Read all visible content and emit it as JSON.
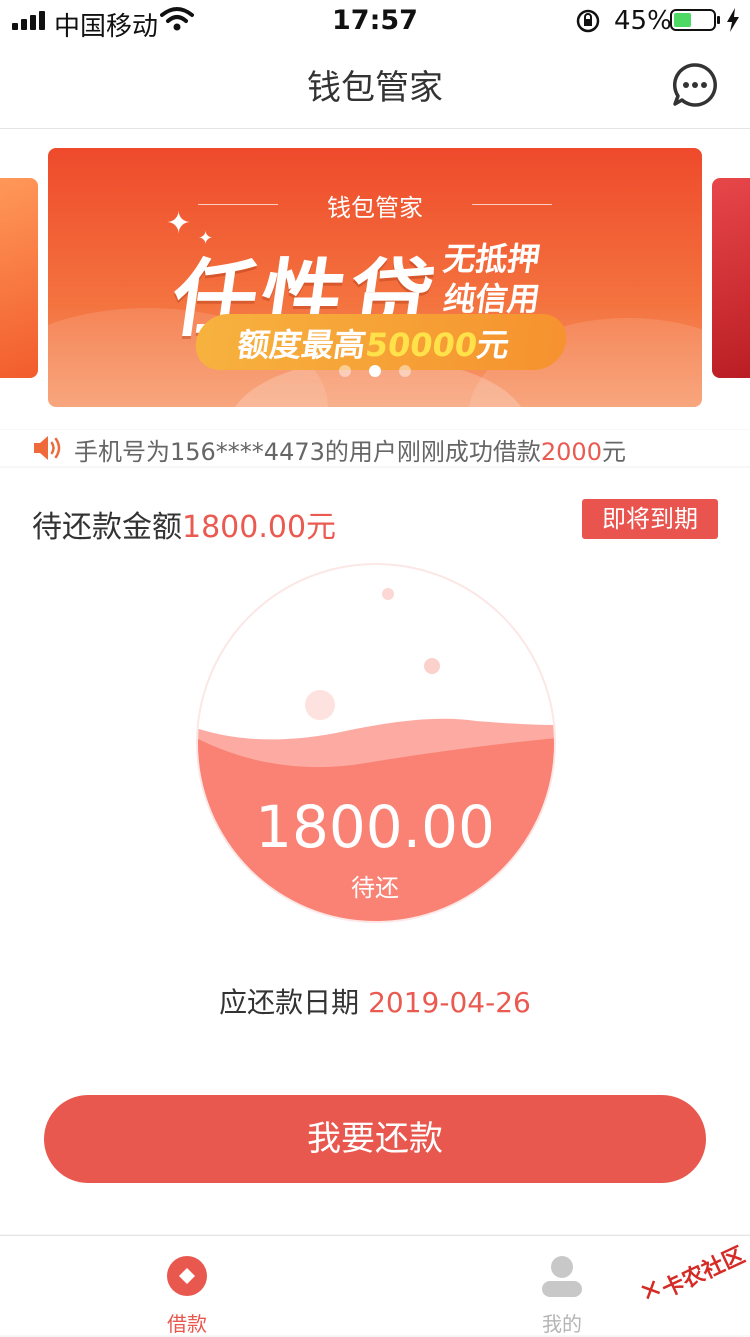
{
  "status_bar": {
    "carrier": "中国移动",
    "time": "17:57",
    "battery_percent": "45%",
    "battery_level": 0.45
  },
  "navbar": {
    "title": "钱包管家",
    "more_icon": "chat-bubble-more-icon"
  },
  "banner": {
    "brand": "钱包管家",
    "headline": "任性贷",
    "side_line1": "无抵押",
    "side_line2": "纯信用",
    "limit_prefix": "额度最高",
    "limit_amount": "50000",
    "limit_unit": "元",
    "page_count": 3,
    "active_page": 2
  },
  "notice": {
    "icon": "speaker-icon",
    "text_prefix": "手机号为156****4473的用户刚刚成功借款",
    "amount": "2000",
    "unit": "元"
  },
  "repayment": {
    "label": "待还款金额",
    "amount_text": "1800.00元",
    "badge": "即将到期",
    "gauge_amount": "1800.00",
    "gauge_label": "待还",
    "due_label": "应还款日期",
    "due_date": "2019-04-26",
    "button": "我要还款"
  },
  "tabbar": {
    "tabs": [
      {
        "label": "借款",
        "icon": "loan-diamond-icon",
        "active": true
      },
      {
        "label": "我的",
        "icon": "user-profile-icon",
        "active": false
      }
    ]
  },
  "watermark": {
    "text": "卡农社区"
  },
  "colors": {
    "accent": "#e9584f",
    "active_tab": "#e9584f",
    "inactive_tab": "#b5b5b5"
  }
}
